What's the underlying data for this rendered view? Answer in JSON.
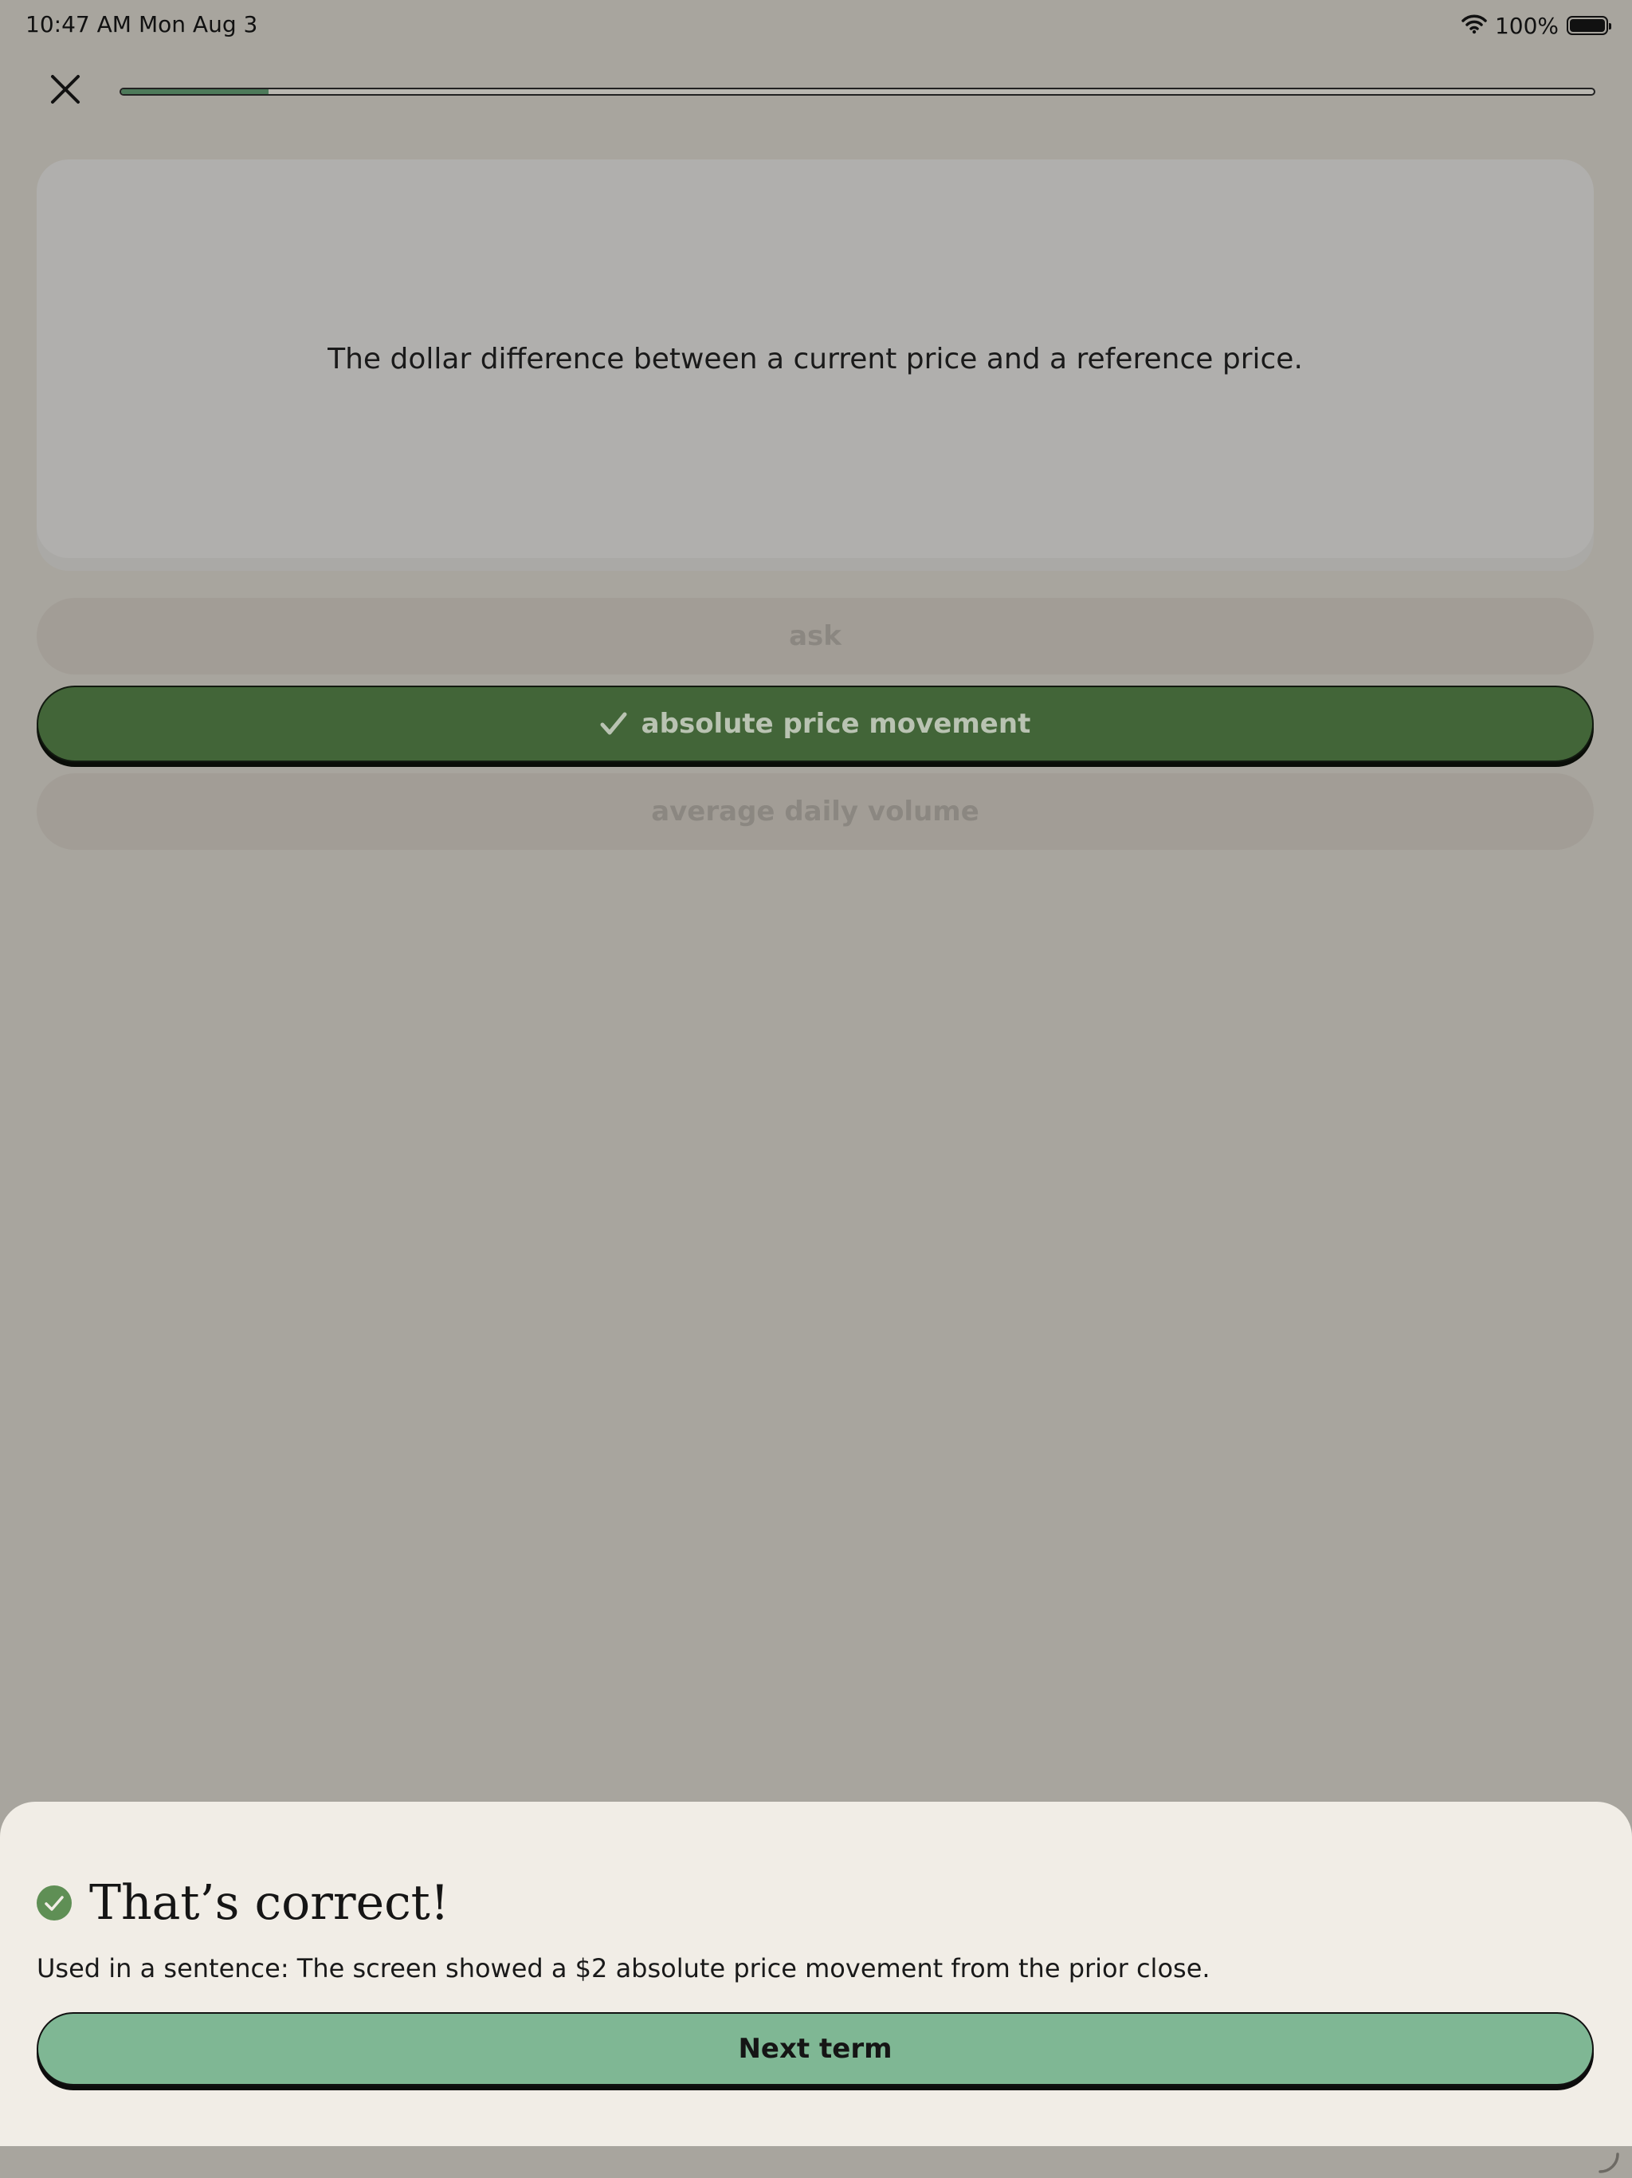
{
  "status_bar": {
    "time": "10:47 AM",
    "date": "Mon Aug 3",
    "battery": "100%",
    "icons": [
      "wifi-icon",
      "battery-icon"
    ]
  },
  "header": {
    "close_icon": "close-icon",
    "progress_fraction": 0.1
  },
  "question": {
    "definition": "The dollar difference between a current price and a reference price."
  },
  "options": [
    {
      "label": "ask",
      "state": "dimmed"
    },
    {
      "label": "absolute price movement",
      "state": "correct",
      "icon": "checkmark-icon"
    },
    {
      "label": "average daily volume",
      "state": "dimmed"
    }
  ],
  "feedback": {
    "icon": "check-circle-icon",
    "title": "That’s correct!",
    "sentence": "Used in a sentence: The screen showed a $2 absolute price movement from the prior close.",
    "next_label": "Next term"
  },
  "colors": {
    "overlay_background": "#a8a59e",
    "correct_green": "#426538",
    "next_button_green": "#7fb794",
    "sheet_background": "#f1ede6",
    "progress_fill": "#4d7a5a"
  }
}
